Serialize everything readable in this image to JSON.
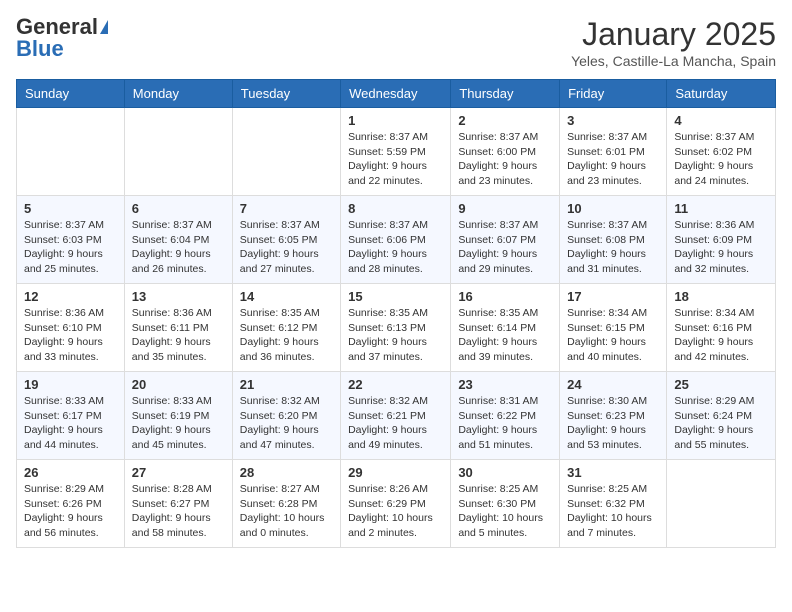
{
  "app": {
    "name_general": "General",
    "name_blue": "Blue"
  },
  "title": "January 2025",
  "location": "Yeles, Castille-La Mancha, Spain",
  "days_of_week": [
    "Sunday",
    "Monday",
    "Tuesday",
    "Wednesday",
    "Thursday",
    "Friday",
    "Saturday"
  ],
  "weeks": [
    [
      {
        "day": "",
        "sunrise": "",
        "sunset": "",
        "daylight": ""
      },
      {
        "day": "",
        "sunrise": "",
        "sunset": "",
        "daylight": ""
      },
      {
        "day": "",
        "sunrise": "",
        "sunset": "",
        "daylight": ""
      },
      {
        "day": "1",
        "sunrise": "Sunrise: 8:37 AM",
        "sunset": "Sunset: 5:59 PM",
        "daylight": "Daylight: 9 hours and 22 minutes."
      },
      {
        "day": "2",
        "sunrise": "Sunrise: 8:37 AM",
        "sunset": "Sunset: 6:00 PM",
        "daylight": "Daylight: 9 hours and 23 minutes."
      },
      {
        "day": "3",
        "sunrise": "Sunrise: 8:37 AM",
        "sunset": "Sunset: 6:01 PM",
        "daylight": "Daylight: 9 hours and 23 minutes."
      },
      {
        "day": "4",
        "sunrise": "Sunrise: 8:37 AM",
        "sunset": "Sunset: 6:02 PM",
        "daylight": "Daylight: 9 hours and 24 minutes."
      }
    ],
    [
      {
        "day": "5",
        "sunrise": "Sunrise: 8:37 AM",
        "sunset": "Sunset: 6:03 PM",
        "daylight": "Daylight: 9 hours and 25 minutes."
      },
      {
        "day": "6",
        "sunrise": "Sunrise: 8:37 AM",
        "sunset": "Sunset: 6:04 PM",
        "daylight": "Daylight: 9 hours and 26 minutes."
      },
      {
        "day": "7",
        "sunrise": "Sunrise: 8:37 AM",
        "sunset": "Sunset: 6:05 PM",
        "daylight": "Daylight: 9 hours and 27 minutes."
      },
      {
        "day": "8",
        "sunrise": "Sunrise: 8:37 AM",
        "sunset": "Sunset: 6:06 PM",
        "daylight": "Daylight: 9 hours and 28 minutes."
      },
      {
        "day": "9",
        "sunrise": "Sunrise: 8:37 AM",
        "sunset": "Sunset: 6:07 PM",
        "daylight": "Daylight: 9 hours and 29 minutes."
      },
      {
        "day": "10",
        "sunrise": "Sunrise: 8:37 AM",
        "sunset": "Sunset: 6:08 PM",
        "daylight": "Daylight: 9 hours and 31 minutes."
      },
      {
        "day": "11",
        "sunrise": "Sunrise: 8:36 AM",
        "sunset": "Sunset: 6:09 PM",
        "daylight": "Daylight: 9 hours and 32 minutes."
      }
    ],
    [
      {
        "day": "12",
        "sunrise": "Sunrise: 8:36 AM",
        "sunset": "Sunset: 6:10 PM",
        "daylight": "Daylight: 9 hours and 33 minutes."
      },
      {
        "day": "13",
        "sunrise": "Sunrise: 8:36 AM",
        "sunset": "Sunset: 6:11 PM",
        "daylight": "Daylight: 9 hours and 35 minutes."
      },
      {
        "day": "14",
        "sunrise": "Sunrise: 8:35 AM",
        "sunset": "Sunset: 6:12 PM",
        "daylight": "Daylight: 9 hours and 36 minutes."
      },
      {
        "day": "15",
        "sunrise": "Sunrise: 8:35 AM",
        "sunset": "Sunset: 6:13 PM",
        "daylight": "Daylight: 9 hours and 37 minutes."
      },
      {
        "day": "16",
        "sunrise": "Sunrise: 8:35 AM",
        "sunset": "Sunset: 6:14 PM",
        "daylight": "Daylight: 9 hours and 39 minutes."
      },
      {
        "day": "17",
        "sunrise": "Sunrise: 8:34 AM",
        "sunset": "Sunset: 6:15 PM",
        "daylight": "Daylight: 9 hours and 40 minutes."
      },
      {
        "day": "18",
        "sunrise": "Sunrise: 8:34 AM",
        "sunset": "Sunset: 6:16 PM",
        "daylight": "Daylight: 9 hours and 42 minutes."
      }
    ],
    [
      {
        "day": "19",
        "sunrise": "Sunrise: 8:33 AM",
        "sunset": "Sunset: 6:17 PM",
        "daylight": "Daylight: 9 hours and 44 minutes."
      },
      {
        "day": "20",
        "sunrise": "Sunrise: 8:33 AM",
        "sunset": "Sunset: 6:19 PM",
        "daylight": "Daylight: 9 hours and 45 minutes."
      },
      {
        "day": "21",
        "sunrise": "Sunrise: 8:32 AM",
        "sunset": "Sunset: 6:20 PM",
        "daylight": "Daylight: 9 hours and 47 minutes."
      },
      {
        "day": "22",
        "sunrise": "Sunrise: 8:32 AM",
        "sunset": "Sunset: 6:21 PM",
        "daylight": "Daylight: 9 hours and 49 minutes."
      },
      {
        "day": "23",
        "sunrise": "Sunrise: 8:31 AM",
        "sunset": "Sunset: 6:22 PM",
        "daylight": "Daylight: 9 hours and 51 minutes."
      },
      {
        "day": "24",
        "sunrise": "Sunrise: 8:30 AM",
        "sunset": "Sunset: 6:23 PM",
        "daylight": "Daylight: 9 hours and 53 minutes."
      },
      {
        "day": "25",
        "sunrise": "Sunrise: 8:29 AM",
        "sunset": "Sunset: 6:24 PM",
        "daylight": "Daylight: 9 hours and 55 minutes."
      }
    ],
    [
      {
        "day": "26",
        "sunrise": "Sunrise: 8:29 AM",
        "sunset": "Sunset: 6:26 PM",
        "daylight": "Daylight: 9 hours and 56 minutes."
      },
      {
        "day": "27",
        "sunrise": "Sunrise: 8:28 AM",
        "sunset": "Sunset: 6:27 PM",
        "daylight": "Daylight: 9 hours and 58 minutes."
      },
      {
        "day": "28",
        "sunrise": "Sunrise: 8:27 AM",
        "sunset": "Sunset: 6:28 PM",
        "daylight": "Daylight: 10 hours and 0 minutes."
      },
      {
        "day": "29",
        "sunrise": "Sunrise: 8:26 AM",
        "sunset": "Sunset: 6:29 PM",
        "daylight": "Daylight: 10 hours and 2 minutes."
      },
      {
        "day": "30",
        "sunrise": "Sunrise: 8:25 AM",
        "sunset": "Sunset: 6:30 PM",
        "daylight": "Daylight: 10 hours and 5 minutes."
      },
      {
        "day": "31",
        "sunrise": "Sunrise: 8:25 AM",
        "sunset": "Sunset: 6:32 PM",
        "daylight": "Daylight: 10 hours and 7 minutes."
      },
      {
        "day": "",
        "sunrise": "",
        "sunset": "",
        "daylight": ""
      }
    ]
  ]
}
